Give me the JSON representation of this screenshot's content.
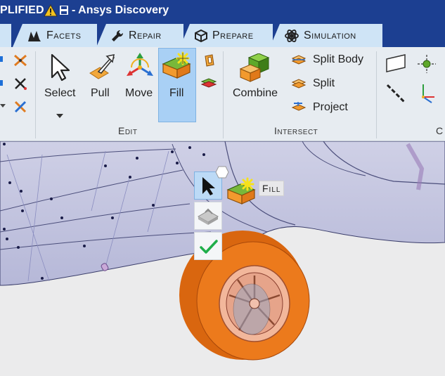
{
  "title": {
    "doc_name": "PLIFIED",
    "app": "- Ansys Discovery"
  },
  "tabs": [
    {
      "label": "Facets"
    },
    {
      "label": "Repair"
    },
    {
      "label": "Prepare"
    },
    {
      "label": "Simulation"
    }
  ],
  "tools": {
    "select": "Select",
    "pull": "Pull",
    "move": "Move",
    "fill": "Fill",
    "combine": "Combine",
    "split_body": "Split Body",
    "split": "Split",
    "project": "Project"
  },
  "groups": {
    "edit": "Edit",
    "intersect": "Intersect",
    "next": "C"
  },
  "mini_toolbar": {
    "fill_tooltip": "Fill"
  },
  "colors": {
    "titlebar": "#1c3f91",
    "tab_bg": "#cfe4f6",
    "ribbon_bg": "#e7ecf1",
    "active_tool": "#a9d0f5",
    "tire": "#e86f17"
  }
}
